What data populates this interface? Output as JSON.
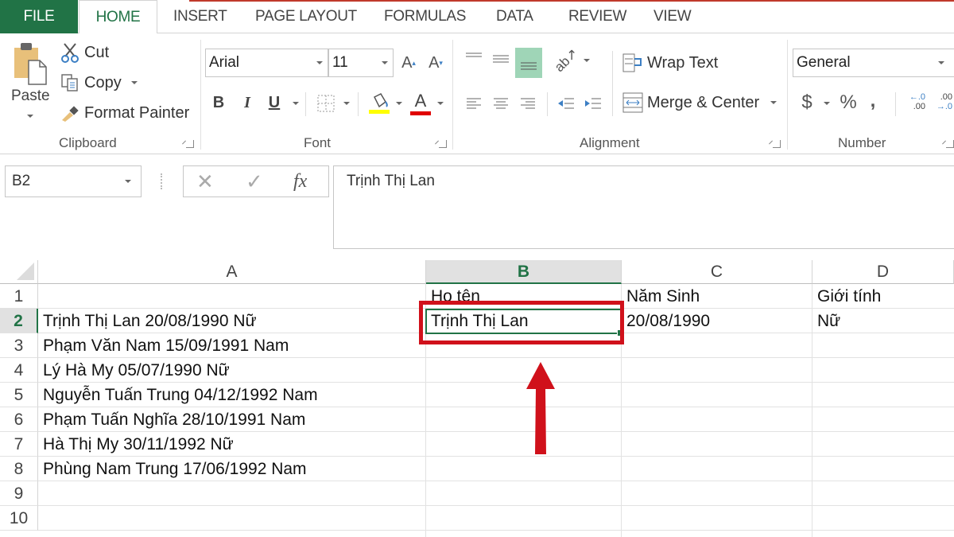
{
  "ribbon_tabs": [
    {
      "label": "FILE"
    },
    {
      "label": "HOME",
      "active": true
    },
    {
      "label": "INSERT"
    },
    {
      "label": "PAGE LAYOUT"
    },
    {
      "label": "FORMULAS"
    },
    {
      "label": "DATA"
    },
    {
      "label": "REVIEW"
    },
    {
      "label": "VIEW"
    }
  ],
  "clipboard": {
    "paste_label": "Paste",
    "cut_label": "Cut",
    "copy_label": "Copy",
    "format_painter_label": "Format Painter",
    "group_label": "Clipboard"
  },
  "font": {
    "font_name": "Arial",
    "font_size": "11",
    "bold_label": "B",
    "italic_label": "I",
    "underline_label": "U",
    "font_color_label": "A",
    "grow_label": "A",
    "shrink_label": "A",
    "fill_color": "#ffff00",
    "text_color": "#e00000",
    "group_label": "Font"
  },
  "alignment": {
    "wrap_text_label": "Wrap Text",
    "merge_center_label": "Merge & Center",
    "group_label": "Alignment"
  },
  "number": {
    "format": "General",
    "currency_label": "$",
    "percent_label": "%",
    "comma_label": ",",
    "inc_decimal_top": "←.0",
    "inc_decimal_bottom": ".00",
    "dec_decimal_top": ".00",
    "dec_decimal_bottom": "→.0",
    "group_label": "Number"
  },
  "formula_bar": {
    "name_box": "B2",
    "cancel_icon": "✕",
    "enter_icon": "✓",
    "fx_label": "fx",
    "content": "Trịnh Thị Lan"
  },
  "sheet": {
    "columns": [
      "A",
      "B",
      "C",
      "D"
    ],
    "selected_column": "B",
    "rows": [
      "1",
      "2",
      "3",
      "4",
      "5",
      "6",
      "7",
      "8",
      "9",
      "10"
    ],
    "selected_row": "2",
    "active_cell": "B2",
    "cells": {
      "B1": "Họ tên",
      "C1": "Năm Sinh",
      "D1": "Giới tính",
      "A2": "Trịnh Thị Lan 20/08/1990 Nữ",
      "B2": "Trịnh Thị Lan",
      "C2": "20/08/1990",
      "D2": "Nữ",
      "A3": "Phạm Văn Nam 15/09/1991 Nam",
      "A4": "Lý Hà My 05/07/1990 Nữ",
      "A5": "Nguyễn Tuấn Trung 04/12/1992 Nam",
      "A6": "Phạm Tuấn Nghĩa 28/10/1991 Nam",
      "A7": "Hà Thị My 30/11/1992 Nữ",
      "A8": "Phùng Nam Trung 17/06/1992 Nam"
    }
  },
  "annotation": {
    "highlight_color": "#d0111b",
    "arrow_color": "#d0111b"
  },
  "colors": {
    "excel_green": "#217346",
    "selected_alignment_bg": "#9fd5b7"
  }
}
